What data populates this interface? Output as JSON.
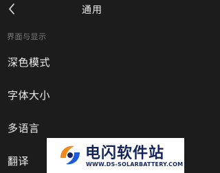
{
  "header": {
    "title": "通用",
    "back_icon": "chevron-left-icon"
  },
  "section": {
    "title": "界面与显示"
  },
  "settings": {
    "items": [
      {
        "label": "深色模式"
      },
      {
        "label": "字体大小"
      },
      {
        "label": "多语言"
      },
      {
        "label": "翻译"
      }
    ]
  },
  "watermark": {
    "title": "电闪软件站",
    "url": "WWW.DS-SOLARBATTERY.COM"
  },
  "colors": {
    "background": "#1c1c1c",
    "text": "#ececec",
    "section_text": "#7d7d7d",
    "watermark_navy": "#14245a",
    "watermark_orange": "#f08a1c",
    "watermark_blue": "#1e5bd8"
  }
}
